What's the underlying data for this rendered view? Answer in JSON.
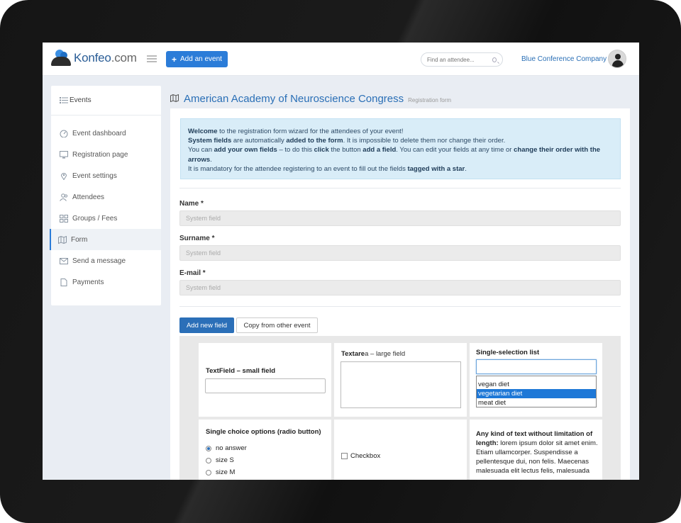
{
  "header": {
    "logo_brand": "Konfeo",
    "logo_domain": ".com",
    "add_event_label": "Add an event",
    "search_placeholder": "Find an attendee...",
    "company": "Blue Conference Company"
  },
  "sidebar": {
    "title": "Events",
    "items": [
      {
        "label": "Event dashboard",
        "icon": "gauge-icon"
      },
      {
        "label": "Registration page",
        "icon": "monitor-icon"
      },
      {
        "label": "Event settings",
        "icon": "location-pin-icon"
      },
      {
        "label": "Attendees",
        "icon": "users-icon"
      },
      {
        "label": "Groups / Fees",
        "icon": "grid-icon"
      },
      {
        "label": "Form",
        "icon": "map-icon",
        "active": true
      },
      {
        "label": "Send a message",
        "icon": "envelope-icon"
      },
      {
        "label": "Payments",
        "icon": "document-icon"
      }
    ]
  },
  "main": {
    "title": "American Academy of Neuroscience Congress",
    "subtitle": "Registration form",
    "info": {
      "l1_b": "Welcome",
      "l1_t": " to the registration form wizard for the attendees of your event!",
      "l2_b1": "System fields",
      "l2_t1": " are automatically ",
      "l2_b2": "added to the form",
      "l2_t2": ". It is impossible to delete them nor change their order.",
      "l3_t1": "You can ",
      "l3_b1": "add your own fields",
      "l3_t2": " – to do this ",
      "l3_b2": "click",
      "l3_t3": " the button ",
      "l3_b3": "add a field",
      "l3_t4": ". You can edit your fields at any time or ",
      "l3_b4": "change their order with the arrows",
      "l3_t5": ".",
      "l4_t": "It is mandatory for the attendee registering to an event to fill out the fields ",
      "l4_b": "tagged with a star",
      "l4_t2": "."
    },
    "fields": [
      {
        "label": "Name *",
        "placeholder": "System field"
      },
      {
        "label": "Surname *",
        "placeholder": "System field"
      },
      {
        "label": "E-mail *",
        "placeholder": "System field"
      }
    ],
    "add_field_label": "Add new field",
    "copy_label": "Copy from other event",
    "preview": {
      "textfield_title": "TextField – small field",
      "textarea_title_b": "Textare",
      "textarea_title_l": "a – large field",
      "select_title": "Single-selection list",
      "select_options": [
        "vegan diet",
        "vegetarian diet",
        "meat diet"
      ],
      "select_highlighted": "vegetarian diet",
      "radio_title": "Single choice options (radio button)",
      "radio_options": [
        "no answer",
        "size S",
        "size M"
      ],
      "radio_selected": "no answer",
      "checkbox_label": "Checkbox",
      "longtext_b": "Any kind of text without limitation of length:",
      "longtext_t": " lorem ipsum dolor sit amet enim. Etiam ullamcorper. Suspendisse a pellentesque dui, non felis. Maecenas malesuada elit lectus felis, malesuada"
    }
  },
  "colors": {
    "accent": "#2b7cd8",
    "info_bg": "#d9edf8",
    "highlight": "#1e78d7"
  }
}
